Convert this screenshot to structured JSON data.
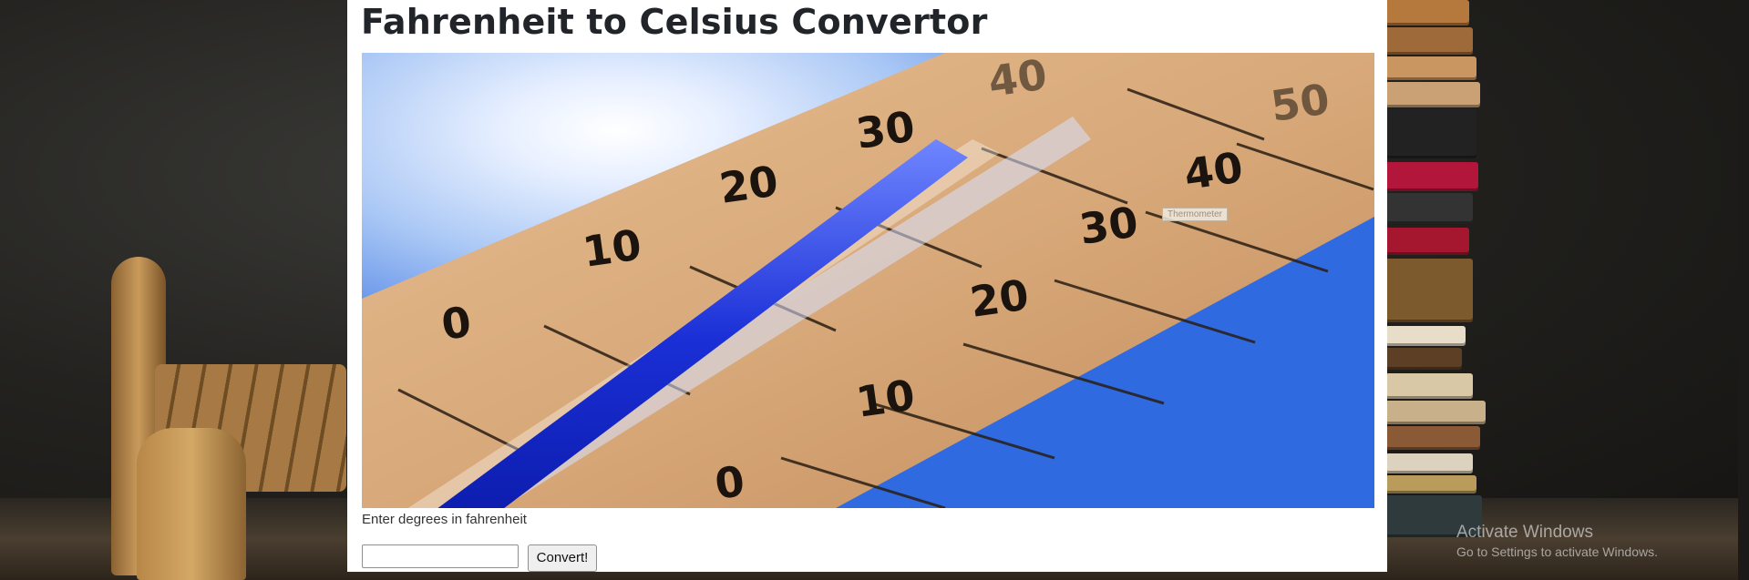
{
  "page": {
    "title": "Fahrenheit to Celsius Convertor",
    "image_alt": "Thermometer",
    "input_label": "Enter degrees in fahrenheit",
    "input_value": "",
    "button_label": "Convert!"
  },
  "thermometer": {
    "celsius_scale": [
      "0",
      "10",
      "20",
      "30",
      "40"
    ],
    "fahrenheit_scale": [
      "0",
      "10",
      "20",
      "30",
      "40",
      "50"
    ]
  },
  "windows_watermark": {
    "line1": "Activate Windows",
    "line2": "Go to Settings to activate Windows."
  },
  "colors": {
    "panel_bg": "#ffffff",
    "title_text": "#212529",
    "mercury": "#1a2fd6",
    "sky": "#2f6ae0",
    "wood": "#d8a97a"
  }
}
